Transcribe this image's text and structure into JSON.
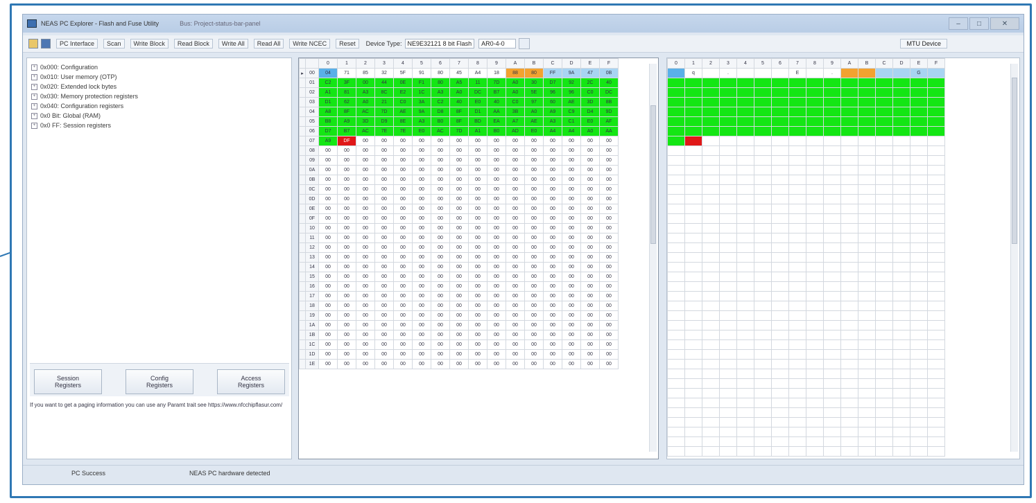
{
  "window": {
    "title": "NEAS PC Explorer - Flash and Fuse Utility",
    "title_extra": "Bus: Project-status-bar-panel"
  },
  "toolbar": {
    "buttons": [
      "PC Interface",
      "Scan",
      "Write Block",
      "Read Block",
      "Write All",
      "Read All",
      "Write NCEC",
      "Reset"
    ],
    "device_type_label": "Device Type:",
    "device_type_value": "NE9E32121 8 bit Flash",
    "address_value": "AR0-4-0",
    "right_button": "MTU Device"
  },
  "tree": [
    "0x000: Configuration",
    "0x010: User memory (OTP)",
    "0x020: Extended lock bytes",
    "0x030: Memory protection registers",
    "0x040: Configuration registers",
    "0x0 Bit: Global (RAM)",
    "0x0 FF: Session registers"
  ],
  "register_buttons": [
    "Session\nRegisters",
    "Config\nRegisters",
    "Access\nRegisters"
  ],
  "info_text": "If you want to get a paging information you can use any Paramt trait see https://www.nfcchipflasur.com/",
  "hex": {
    "col_headers": [
      "0",
      "1",
      "2",
      "3",
      "4",
      "5",
      "6",
      "7",
      "8",
      "9",
      "A",
      "B",
      "C",
      "D",
      "E",
      "F"
    ],
    "row_labels": [
      "00",
      "01",
      "02",
      "03",
      "04",
      "05",
      "06",
      "07",
      "08",
      "09",
      "0A",
      "0B",
      "0C",
      "0D",
      "0E",
      "0F",
      "10",
      "11",
      "12",
      "13",
      "14",
      "15",
      "16",
      "17",
      "18",
      "19",
      "1A",
      "1B",
      "1C",
      "1D",
      "1E"
    ],
    "row0": [
      "04",
      "71",
      "85",
      "32",
      "5F",
      "91",
      "80",
      "45",
      "A4",
      "18",
      "88",
      "80",
      "FF",
      "9A",
      "47",
      "0B"
    ],
    "green_rows": [
      [
        "C2",
        "3F",
        "00",
        "44",
        "0E",
        "F1",
        "80",
        "A5",
        "11",
        "7D",
        "A0",
        "30",
        "D7",
        "92",
        "2C",
        "40"
      ],
      [
        "A1",
        "81",
        "A3",
        "8C",
        "E2",
        "1C",
        "A3",
        "A0",
        "DC",
        "B7",
        "A0",
        "5E",
        "96",
        "96",
        "C0",
        "DC"
      ],
      [
        "D1",
        "62",
        "A0",
        "21",
        "C0",
        "3A",
        "C2",
        "40",
        "E0",
        "40",
        "C0",
        "97",
        "60",
        "AE",
        "3D",
        "8B"
      ],
      [
        "A8",
        "8F",
        "AC",
        "7D",
        "AE",
        "9A",
        "D8",
        "8F",
        "D1",
        "AA",
        "3B",
        "A0",
        "A9",
        "C9",
        "D4",
        "9D"
      ],
      [
        "B8",
        "A9",
        "3D",
        "D9",
        "8E",
        "A3",
        "B0",
        "8F",
        "BD",
        "EA",
        "A7",
        "AE",
        "A3",
        "C1",
        "E0",
        "AF"
      ],
      [
        "D7",
        "B7",
        "AC",
        "7E",
        "7E",
        "E0",
        "AC",
        "7D",
        "A1",
        "B0",
        "AD",
        "E0",
        "A4",
        "A4",
        "A0",
        "AA"
      ]
    ],
    "row7_first": "A9",
    "row7_red": "DF",
    "filler": "00"
  },
  "ascii": {
    "col_headers": [
      "0",
      "1",
      "2",
      "3",
      "4",
      "5",
      "6",
      "7",
      "8",
      "9",
      "A",
      "B",
      "C",
      "D",
      "E",
      "F"
    ],
    "row0": [
      " ",
      "q",
      "",
      ".",
      "",
      "",
      "",
      "E",
      "",
      ".",
      "",
      "",
      "",
      "",
      "G",
      ""
    ],
    "row7_first": "",
    "row7_red": ""
  },
  "status": {
    "left": "PC Success",
    "right": "NEAS PC hardware detected"
  }
}
